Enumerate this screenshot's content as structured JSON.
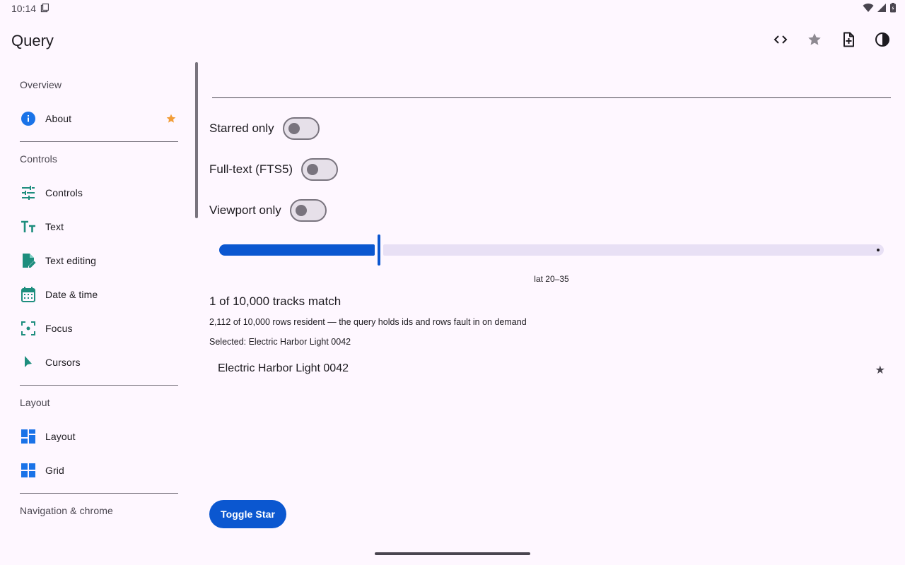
{
  "status_bar": {
    "time": "10:14"
  },
  "app_bar": {
    "title": "Query",
    "actions": [
      "code-icon",
      "star-icon",
      "note-add-icon",
      "contrast-icon"
    ]
  },
  "sidebar": {
    "sections": [
      {
        "header": "Overview",
        "items": [
          {
            "label": "About",
            "icon": "info-icon",
            "starred": true
          }
        ]
      },
      {
        "header": "Controls",
        "items": [
          {
            "label": "Controls",
            "icon": "tune-icon"
          },
          {
            "label": "Text",
            "icon": "text-fields-icon"
          },
          {
            "label": "Text editing",
            "icon": "edit-document-icon"
          },
          {
            "label": "Date & time",
            "icon": "calendar-icon"
          },
          {
            "label": "Focus",
            "icon": "center-focus-icon"
          },
          {
            "label": "Cursors",
            "icon": "pointer-icon"
          }
        ]
      },
      {
        "header": "Layout",
        "items": [
          {
            "label": "Layout",
            "icon": "dashboard-icon"
          },
          {
            "label": "Grid",
            "icon": "grid-icon"
          }
        ]
      },
      {
        "header": "Navigation & chrome",
        "items": []
      }
    ]
  },
  "main": {
    "search": {
      "value": "",
      "placeholder": ""
    },
    "toggles": [
      {
        "label": "Starred only",
        "on": false
      },
      {
        "label": "Full-text (FTS5)",
        "on": false
      },
      {
        "label": "Viewport only",
        "on": false
      }
    ],
    "slider": {
      "fraction": 0.24,
      "caption": "lat 20–35"
    },
    "match_count": "1 of 10,000 tracks match",
    "resident_note": "2,112 of 10,000 rows resident — the query holds ids and rows fault in on demand",
    "selected_note": "Selected: Electric Harbor Light 0042",
    "results": [
      {
        "title": "Electric Harbor Light 0042",
        "star": "★"
      }
    ],
    "toggle_button": "Toggle Star"
  },
  "colors": {
    "accent": "#0B57D0",
    "background": "#FEF7FF",
    "star": "#F29D38",
    "icon_green": "#1E8E7E",
    "icon_blue": "#1A73E8"
  }
}
